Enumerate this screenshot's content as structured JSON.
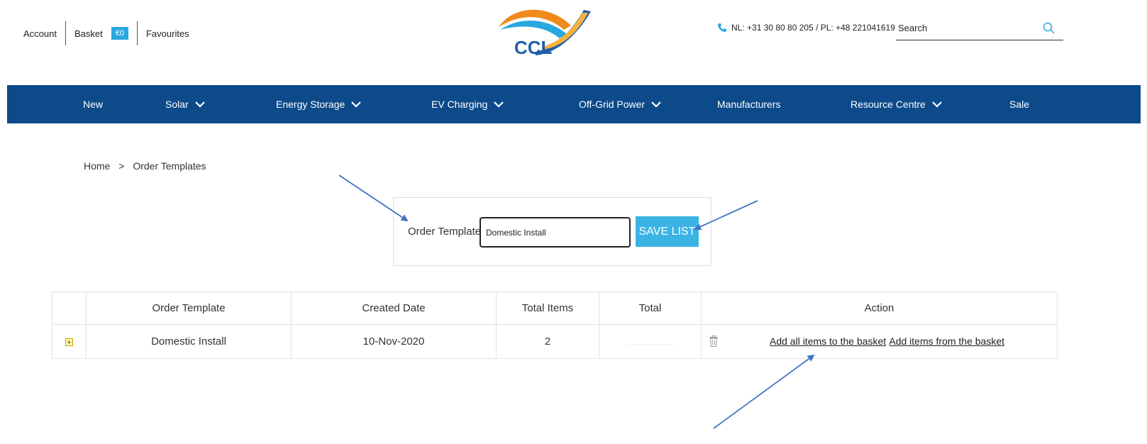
{
  "header": {
    "account_label": "Account",
    "basket_label": "Basket",
    "basket_amount": "€0",
    "favourites_label": "Favourites",
    "logo_text": "CCL",
    "phone": "NL: +31 30 80 80 205 / PL: +48 221041619",
    "search_placeholder": "Search"
  },
  "nav": {
    "items": [
      {
        "label": "New"
      },
      {
        "label": "Solar"
      },
      {
        "label": "Energy Storage"
      },
      {
        "label": "EV Charging"
      },
      {
        "label": "Off-Grid Power"
      },
      {
        "label": "Manufacturers"
      },
      {
        "label": "Resource Centre"
      },
      {
        "label": "Sale"
      }
    ]
  },
  "breadcrumb": {
    "home": "Home",
    "separator": ">",
    "current": "Order Templates"
  },
  "form": {
    "label": "Order Template",
    "value": "Domestic Install",
    "save_label": "SAVE LIST"
  },
  "table": {
    "headers": [
      "Order Template",
      "Created Date",
      "Total Items",
      "Total",
      "Action"
    ],
    "rows": [
      {
        "name": "Domestic Install",
        "created": "10-Nov-2020",
        "total_items": "2",
        "total": "",
        "add_all_label": "Add all items to the basket",
        "add_from_label": "Add items from the basket"
      }
    ]
  },
  "colors": {
    "nav_bg": "#0c4a8a",
    "accent": "#3bb4e5",
    "annotation_arrow": "#4472c4"
  }
}
